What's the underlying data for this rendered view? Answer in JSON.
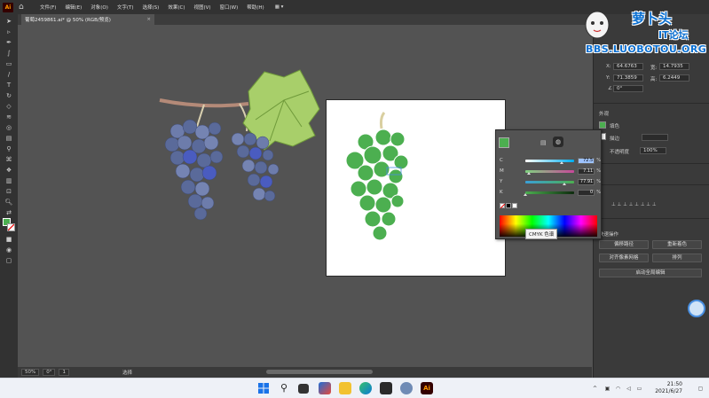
{
  "menubar": {
    "logo": "Ai",
    "items": [
      "文件(F)",
      "编辑(E)",
      "对象(O)",
      "文字(T)",
      "选择(S)",
      "效果(C)",
      "视图(V)",
      "窗口(W)",
      "帮助(H)"
    ]
  },
  "document_tab": {
    "title": "葡萄2459861.ai* @ 50% (RGB/预览)",
    "close": "×"
  },
  "status": {
    "zoom": "50%",
    "rotation": "0°",
    "artboard_index": "1",
    "tool_name": "选择"
  },
  "properties": {
    "x_label": "X:",
    "x_value": "64.6763",
    "y_label": "Y:",
    "y_value": "71.3859",
    "w_label": "宽:",
    "w_value": "14.7935",
    "h_label": "高:",
    "h_value": "6.2449 ",
    "angle_value": "0°",
    "appearance_header": "外观",
    "fill_label": "填色",
    "stroke_label": "描边",
    "opacity_label": "不透明度",
    "opacity_value": "100%",
    "quick_actions_header": "快速操作",
    "btn_offset_path": "偏移路径",
    "btn_recolor": "重新着色",
    "btn_align_pixel": "对齐像素网格",
    "btn_arrange": "排列",
    "btn_global_edit": "启动全局编辑"
  },
  "color_panel": {
    "rows": [
      {
        "label": "C",
        "value": "72.5",
        "selected": true
      },
      {
        "label": "M",
        "value": "7.11",
        "selected": false
      },
      {
        "label": "Y",
        "value": "77.91",
        "selected": false
      },
      {
        "label": "K",
        "value": "0",
        "selected": false
      }
    ],
    "percent": "%",
    "tooltip": "CMYK 色谱",
    "cmyk": {
      "C": 72.5,
      "M": 7.11,
      "Y": 77.91,
      "K": 0
    }
  },
  "watermark": {
    "line1": "萝卜头",
    "line2": "IT论坛",
    "line3": "BBS.LUOBOTOU.ORG"
  },
  "taskbar": {
    "time": "21:50",
    "date": "2021/6/27"
  },
  "colors": {
    "fill_green": "#4caf50",
    "grape_blue": "#5a6a9a",
    "leaf_green": "#a8cf6a",
    "stem_brown": "#b48a78"
  }
}
